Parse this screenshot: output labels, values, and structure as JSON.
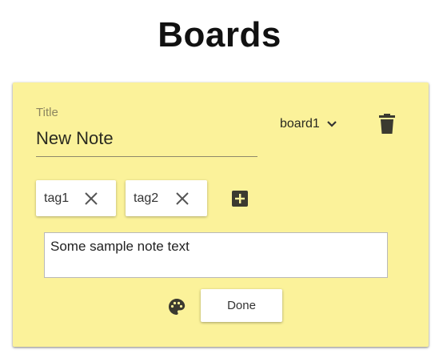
{
  "page": {
    "title": "Boards"
  },
  "note": {
    "background_color": "#fbf29a",
    "title_label": "Title",
    "title_value": "New Note",
    "board": "board1",
    "board_dropdown_icon": "chevron-down-icon",
    "delete_icon": "trash-icon",
    "tags": [
      {
        "label": "tag1",
        "remove_icon": "close-icon"
      },
      {
        "label": "tag2",
        "remove_icon": "close-icon"
      }
    ],
    "add_tag_icon": "plus-box-icon",
    "text": "Some sample note text",
    "palette_icon": "palette-icon",
    "done_label": "Done"
  }
}
